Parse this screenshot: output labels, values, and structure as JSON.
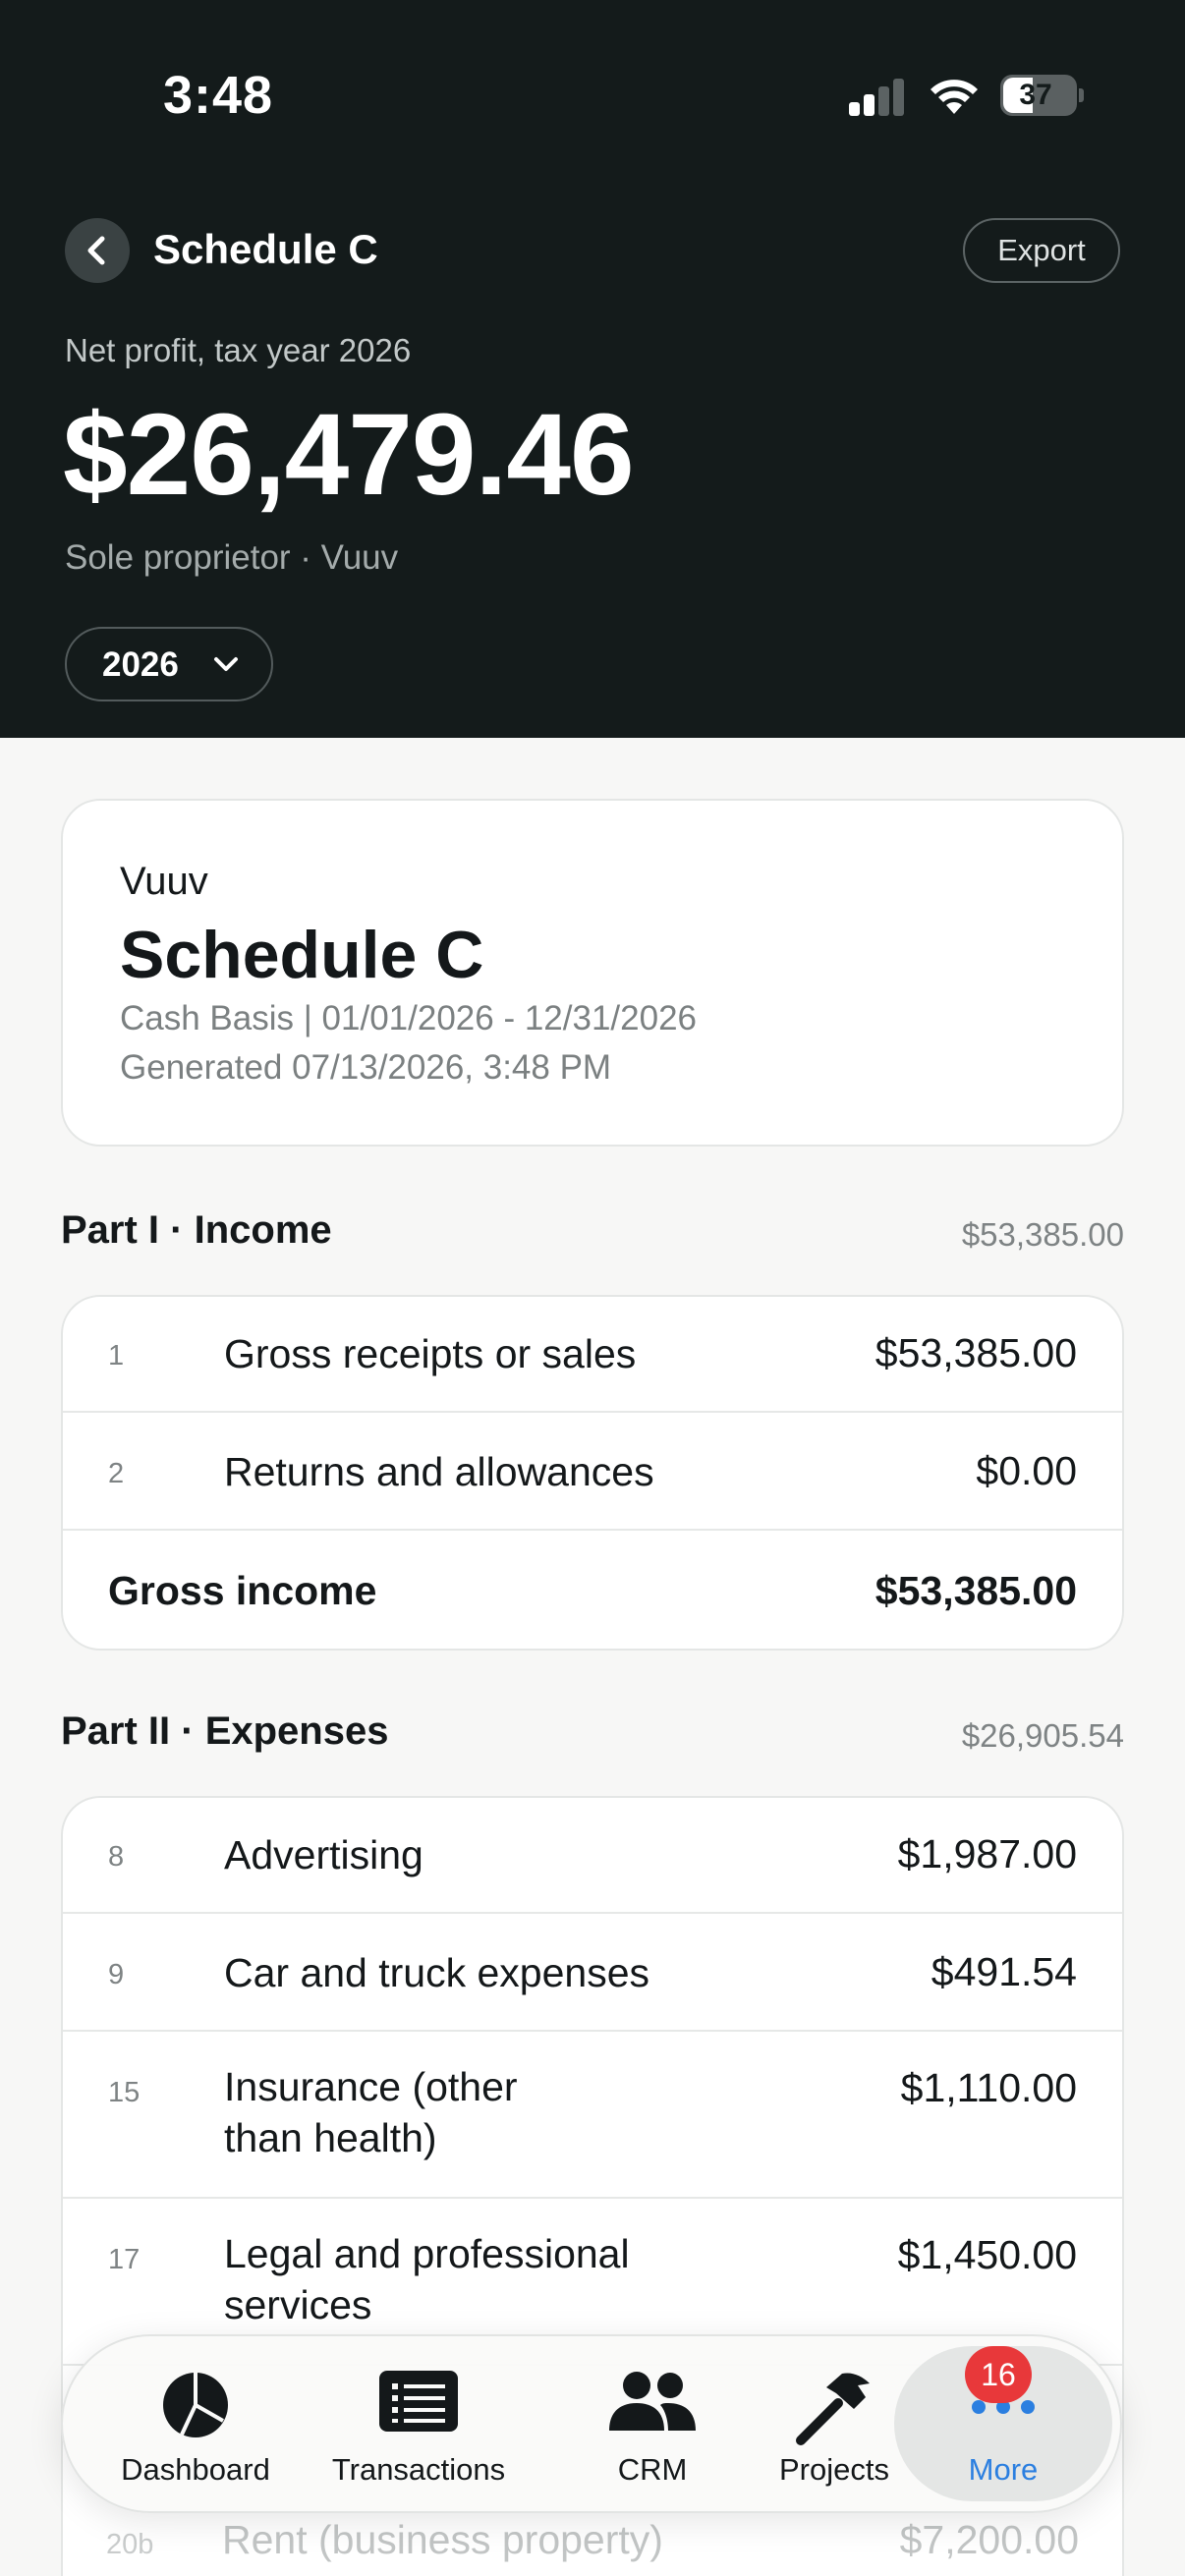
{
  "status_bar": {
    "time": "3:48",
    "battery": "37"
  },
  "header": {
    "title": "Schedule C",
    "export_label": "Export",
    "net_label": "Net profit, tax year 2026",
    "net_amount": "$26,479.46",
    "entity_line": "Sole proprietor · Vuuv",
    "year": "2026"
  },
  "report": {
    "company": "Vuuv",
    "title": "Schedule C",
    "basis": "Cash Basis | 01/01/2026 - 12/31/2026",
    "generated": "Generated 07/13/2026, 3:48 PM"
  },
  "income": {
    "title": "Part I · Income",
    "total": "$53,385.00",
    "rows": [
      {
        "num": "1",
        "desc": "Gross receipts or sales",
        "amount": "$53,385.00"
      },
      {
        "num": "2",
        "desc": "Returns and allowances",
        "amount": "$0.00"
      }
    ],
    "gross_label": "Gross income",
    "gross_amount": "$53,385.00"
  },
  "expenses": {
    "title": "Part II · Expenses",
    "total": "$26,905.54",
    "rows": [
      {
        "num": "8",
        "desc": "Advertising",
        "amount": "$1,987.00"
      },
      {
        "num": "9",
        "desc": "Car and truck expenses",
        "amount": "$491.54"
      },
      {
        "num": "15",
        "desc_line1": "Insurance (other",
        "desc_line2": "than health)",
        "amount": "$1,110.00"
      },
      {
        "num": "17",
        "desc_line1": "Legal and professional",
        "desc_line2": "services",
        "amount": "$1,450.00"
      },
      {
        "num": "20b",
        "desc": "Rent (business property)",
        "amount": "$7,200.00"
      }
    ]
  },
  "tabs": [
    {
      "label": "Dashboard",
      "icon": "pie-chart-icon"
    },
    {
      "label": "Transactions",
      "icon": "list-icon"
    },
    {
      "label": "CRM",
      "icon": "people-icon"
    },
    {
      "label": "Projects",
      "icon": "hammer-icon"
    },
    {
      "label": "More",
      "icon": "ellipsis-icon",
      "active": true,
      "badge": "16"
    }
  ],
  "colors": {
    "header_bg": "#141b1b",
    "accent": "#2b7fe0",
    "badge": "#e8383a"
  }
}
